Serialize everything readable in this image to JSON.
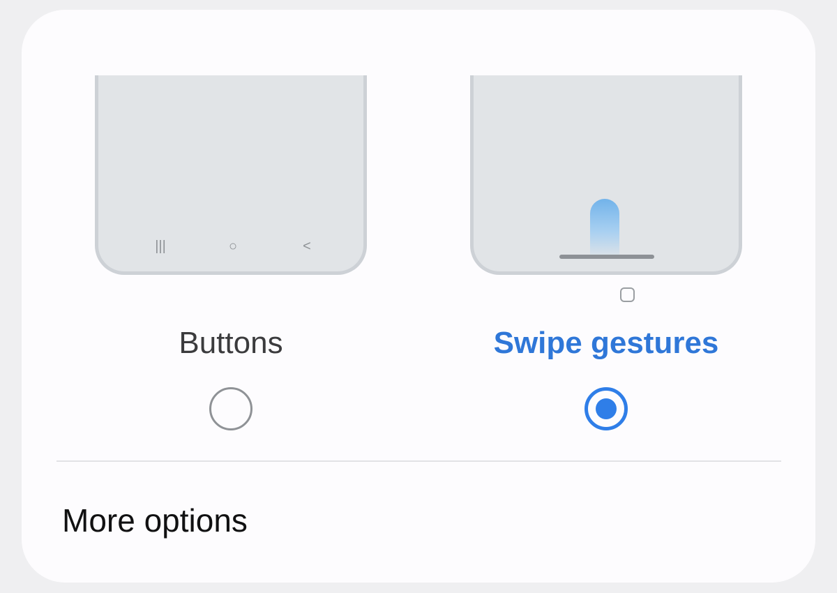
{
  "navigation_type": {
    "options": [
      {
        "label": "Buttons",
        "selected": false,
        "nav_icons": {
          "recents": "|||",
          "home": "○",
          "back": "<"
        }
      },
      {
        "label": "Swipe gestures",
        "selected": true
      }
    ]
  },
  "more_options": {
    "label": "More options"
  },
  "colors": {
    "accent": "#2f7ee8",
    "selected_label": "#2f77d8",
    "card_background": "#fdfcfe",
    "page_background": "#efeff1",
    "preview_fill": "#e1e4e7"
  }
}
